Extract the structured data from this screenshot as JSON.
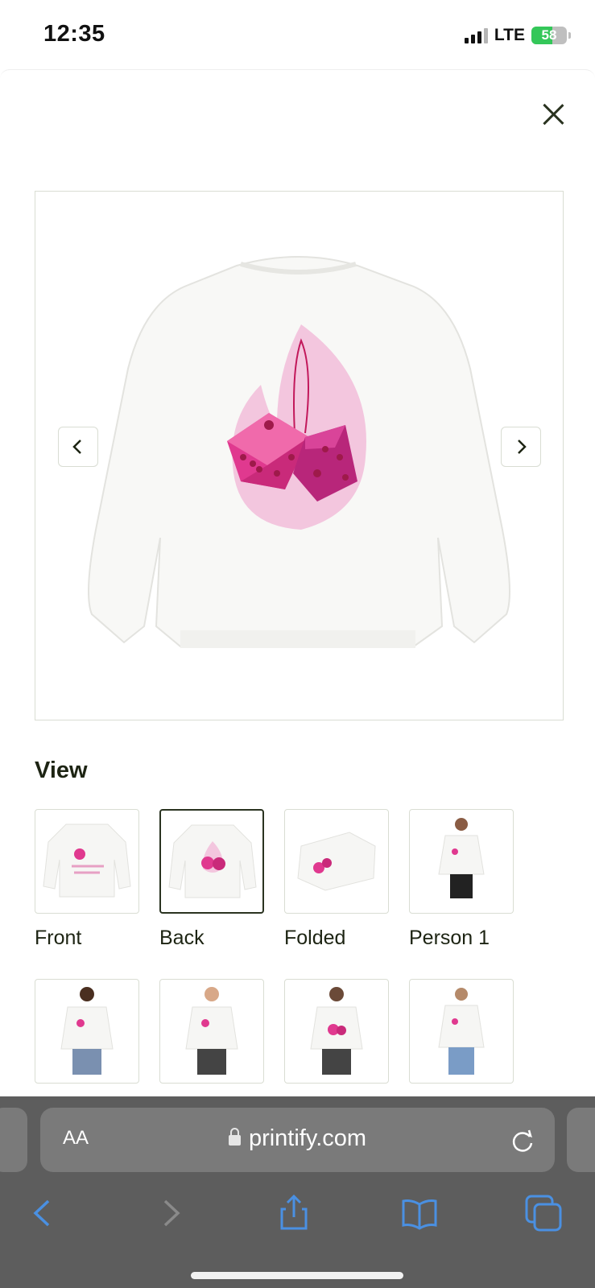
{
  "status_bar": {
    "time": "12:35",
    "network": "LTE",
    "battery": "58",
    "battery_level_percent": 58
  },
  "url_bar": {
    "text_size_label": "AA",
    "domain": "printify.com"
  },
  "product_viewer": {
    "section_title": "View",
    "selected_view": "Back",
    "thumbnails": [
      {
        "label": "Front",
        "image": "sweatshirt-front"
      },
      {
        "label": "Back",
        "image": "sweatshirt-back"
      },
      {
        "label": "Folded",
        "image": "sweatshirt-folded"
      },
      {
        "label": "Person 1",
        "image": "model-front-woman"
      },
      {
        "label": "",
        "image": "model-front-man"
      },
      {
        "label": "",
        "image": "model-front-man-2"
      },
      {
        "label": "",
        "image": "model-back-man"
      },
      {
        "label": "",
        "image": "model-front-woman-2"
      }
    ]
  },
  "colors": {
    "text": "#1d2413",
    "border": "#d9ddd3",
    "dice_pink": "#e0398f",
    "flame_pink": "#f3c6de",
    "browser_bar": "#5d5d5d",
    "toolbar_icon": "#4a90e2"
  },
  "icons": {
    "close": "close-icon",
    "prev": "chevron-left-icon",
    "next": "chevron-right-icon",
    "lock": "lock-icon",
    "reload": "reload-icon",
    "back": "back-arrow-icon",
    "forward": "forward-arrow-icon",
    "share": "share-icon",
    "bookmarks": "bookmarks-icon",
    "tabs": "tabs-icon"
  }
}
